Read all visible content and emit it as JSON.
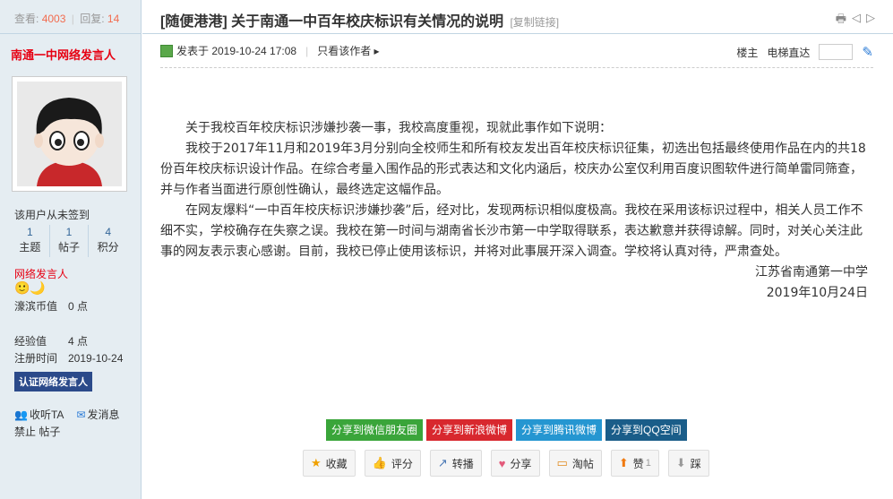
{
  "left": {
    "views_label": "查看:",
    "views": "4003",
    "replies_label": "回复:",
    "replies": "14",
    "author": "南通一中网络发言人",
    "signin": "该用户从未签到",
    "stats": [
      {
        "value": "1",
        "label": "主题"
      },
      {
        "value": "1",
        "label": "帖子"
      },
      {
        "value": "4",
        "label": "积分"
      }
    ],
    "group": "网络发言人",
    "medals": "🙂🌙",
    "fields": [
      {
        "k": "濠滨币值",
        "v": "0 点"
      },
      {
        "k": "经验值",
        "v": "4 点"
      },
      {
        "k": "注册时间",
        "v": "2019-10-24"
      }
    ],
    "badge": "认证网络发言人",
    "listen": "收听TA",
    "message": "发消息",
    "ban": "禁止 帖子"
  },
  "header": {
    "title": "[随便港港] 关于南通一中百年校庆标识有关情况的说明",
    "copy_link": "[复制链接]"
  },
  "meta": {
    "posted": "发表于 2019-10-24 17:08",
    "only_author": "只看该作者 ▸",
    "floor": "楼主",
    "elevator": "电梯直达"
  },
  "content": {
    "p1": "关于我校百年校庆标识涉嫌抄袭一事，我校高度重视，现就此事作如下说明：",
    "p2": "我校于2017年11月和2019年3月分别向全校师生和所有校友发出百年校庆标识征集，初选出包括最终使用作品在内的共18份百年校庆标识设计作品。在综合考量入围作品的形式表达和文化内涵后，校庆办公室仅利用百度识图软件进行简单雷同筛查，并与作者当面进行原创性确认，最终选定这幅作品。",
    "p3": "在网友爆料“一中百年校庆标识涉嫌抄袭”后，经对比，发现两标识相似度极高。我校在采用该标识过程中，相关人员工作不细不实，学校确存在失察之误。我校在第一时间与湖南省长沙市第一中学取得联系，表达歉意并获得谅解。同时，对关心关注此事的网友表示衷心感谢。目前，我校已停止使用该标识，并将对此事展开深入调查。学校将认真对待，严肃查处。",
    "sign_org": "江苏省南通第一中学",
    "sign_date": "2019年10月24日"
  },
  "share": {
    "wechat": "分享到微信朋友圈",
    "weibo": "分享到新浪微博",
    "tencent": "分享到腾讯微博",
    "qzone": "分享到QQ空间"
  },
  "actions": {
    "favorite": "收藏",
    "rate": "评分",
    "repost": "转播",
    "share": "分享",
    "taotie": "淘帖",
    "like": "赞",
    "like_count": "1",
    "dislike": "踩"
  }
}
